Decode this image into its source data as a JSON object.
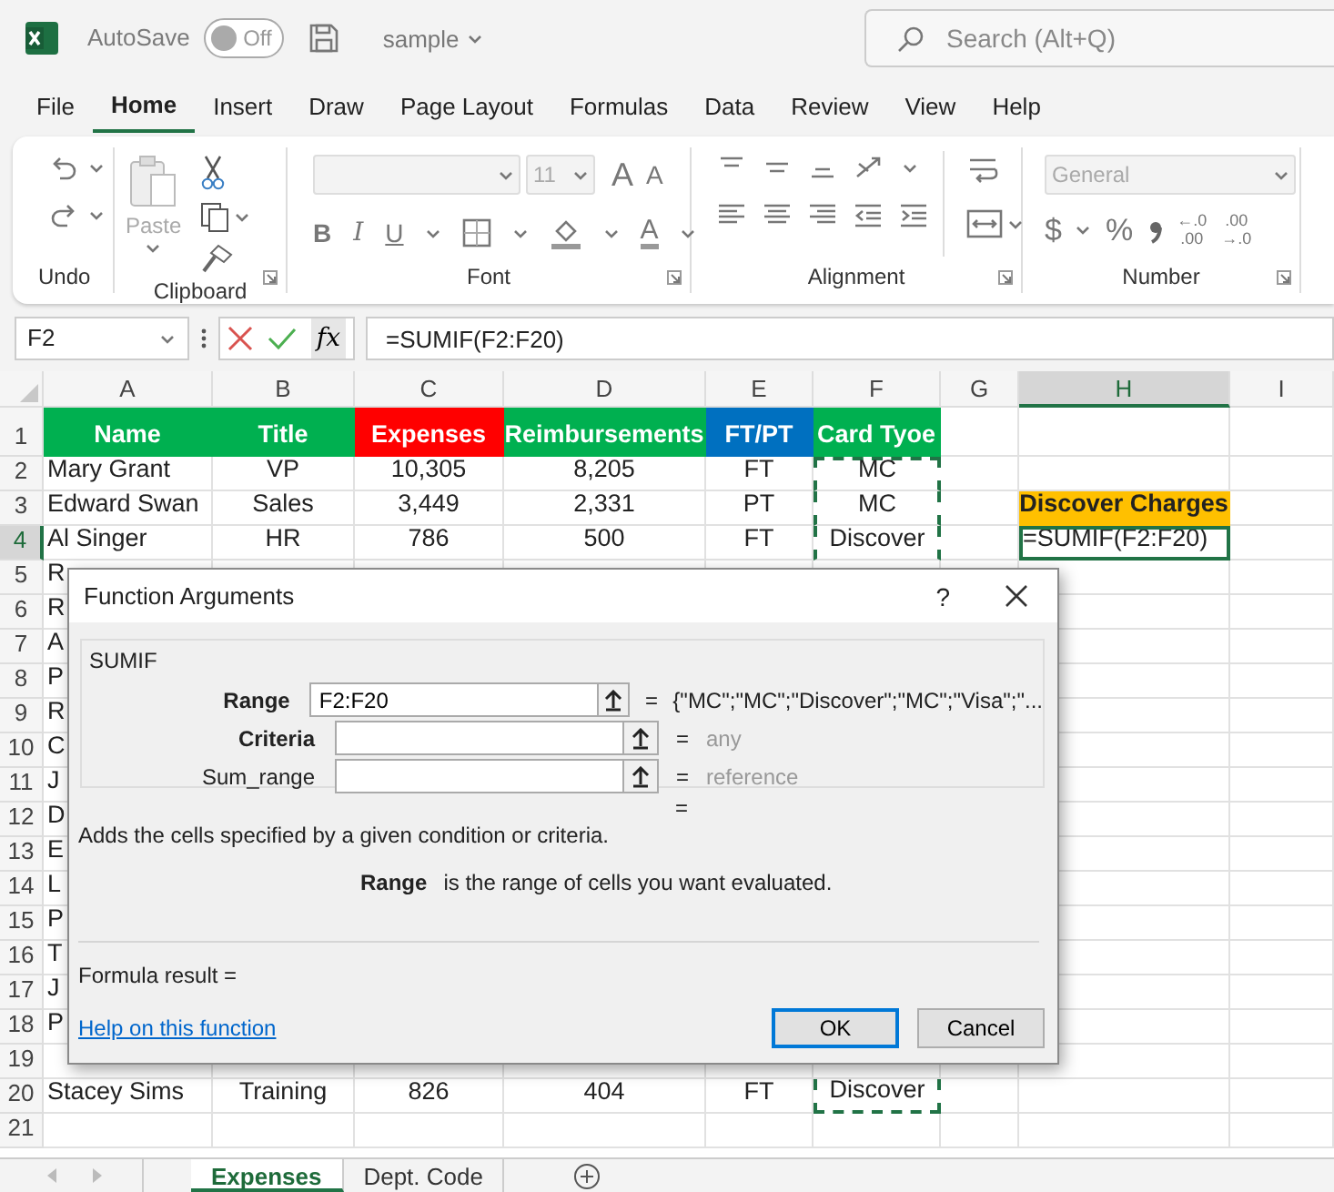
{
  "title_bar": {
    "autosave_label": "AutoSave",
    "autosave_on": false,
    "autosave_state": "Off",
    "file_name": "sample",
    "search_placeholder": "Search (Alt+Q)"
  },
  "menu_tabs": [
    {
      "label": "File",
      "selected": false
    },
    {
      "label": "Home",
      "selected": true
    },
    {
      "label": "Insert",
      "selected": false
    },
    {
      "label": "Draw",
      "selected": false
    },
    {
      "label": "Page Layout",
      "selected": false
    },
    {
      "label": "Formulas",
      "selected": false
    },
    {
      "label": "Data",
      "selected": false
    },
    {
      "label": "Review",
      "selected": false
    },
    {
      "label": "View",
      "selected": false
    },
    {
      "label": "Help",
      "selected": false
    }
  ],
  "ribbon": {
    "groups": [
      {
        "kind": "undo",
        "label": "Undo",
        "launcher": false
      },
      {
        "kind": "clipboard",
        "label": "Clipboard",
        "launcher": true
      },
      {
        "kind": "font",
        "label": "Font",
        "launcher": true
      },
      {
        "kind": "alignment",
        "label": "Alignment",
        "launcher": true
      },
      {
        "kind": "number",
        "label": "Number",
        "launcher": true
      }
    ],
    "paste_label": "Paste",
    "font_size": "11",
    "number_format": "General",
    "font_glyphs": {
      "grow": "A",
      "shrink": "A",
      "bold": "B",
      "italic": "I",
      "underline": "U",
      "font_colour": "A"
    },
    "number_glyphs": {
      "currency": "$",
      "percent": "%"
    },
    "decimal_increase": [
      "←.0",
      ".00"
    ],
    "decimal_decrease": [
      ".00",
      "→.0"
    ]
  },
  "formula_bar": {
    "name_box": "F2",
    "insert_function": "fx",
    "formula": "=SUMIF(F2:F20)"
  },
  "sheet": {
    "columns": [
      {
        "label": "A",
        "selected": false
      },
      {
        "label": "B",
        "selected": false
      },
      {
        "label": "C",
        "selected": false
      },
      {
        "label": "D",
        "selected": false
      },
      {
        "label": "E",
        "selected": false
      },
      {
        "label": "F",
        "selected": false
      },
      {
        "label": "G",
        "selected": false
      },
      {
        "label": "H",
        "selected": true
      },
      {
        "label": "I",
        "selected": false
      }
    ],
    "rows": [
      {
        "number": "1",
        "selected": false,
        "cells": [
          {
            "text": "Name",
            "color": "#00b050",
            "selected": false,
            "marquee": false
          },
          {
            "text": "Title",
            "color": "#00b050",
            "selected": false,
            "marquee": false
          },
          {
            "text": "Expenses",
            "color": "#ff0000",
            "selected": false,
            "marquee": false
          },
          {
            "text": "Reimbursements",
            "color": "#00b050",
            "selected": false,
            "marquee": false
          },
          {
            "text": "FT/PT",
            "color": "#0070c0",
            "selected": false,
            "marquee": false
          },
          {
            "text": "Card Tyoe",
            "color": "#00b050",
            "selected": false,
            "marquee": false
          }
        ]
      },
      {
        "number": "2",
        "selected": false,
        "cells": [
          {
            "text": "Mary Grant",
            "selected": false,
            "marquee": false
          },
          {
            "text": "VP",
            "selected": false,
            "marquee": false
          },
          {
            "text": "10,305",
            "selected": false,
            "marquee": false
          },
          {
            "text": "8,205",
            "selected": false,
            "marquee": false
          },
          {
            "text": "FT",
            "selected": false,
            "marquee": false
          },
          {
            "text": "MC",
            "selected": false,
            "marquee": true
          }
        ]
      },
      {
        "number": "3",
        "selected": false,
        "cells": [
          {
            "text": "Edward Swan",
            "selected": false,
            "marquee": false
          },
          {
            "text": "Sales",
            "selected": false,
            "marquee": false
          },
          {
            "text": "3,449",
            "selected": false,
            "marquee": false
          },
          {
            "text": "2,331",
            "selected": false,
            "marquee": false
          },
          {
            "text": "PT",
            "selected": false,
            "marquee": false
          },
          {
            "text": "MC",
            "selected": false,
            "marquee": true
          },
          null,
          {
            "text": "Discover Charges",
            "color": "#ffc000",
            "selected": false,
            "marquee": false
          }
        ]
      },
      {
        "number": "4",
        "selected": true,
        "cells": [
          {
            "text": "Al Singer",
            "selected": false,
            "marquee": false
          },
          {
            "text": "HR",
            "selected": false,
            "marquee": false
          },
          {
            "text": "786",
            "selected": false,
            "marquee": false
          },
          {
            "text": "500",
            "selected": false,
            "marquee": false
          },
          {
            "text": "FT",
            "selected": false,
            "marquee": false
          },
          {
            "text": "Discover",
            "selected": false,
            "marquee": true
          },
          null,
          {
            "text": "=SUMIF(F2:F20)",
            "selected": true,
            "marquee": false
          }
        ]
      },
      {
        "number": "5",
        "selected": false,
        "cells": [
          {
            "text": "R",
            "selected": false,
            "marquee": false
          }
        ]
      },
      {
        "number": "6",
        "selected": false,
        "cells": [
          {
            "text": "R",
            "selected": false,
            "marquee": false
          }
        ]
      },
      {
        "number": "7",
        "selected": false,
        "cells": [
          {
            "text": "A",
            "selected": false,
            "marquee": false
          }
        ]
      },
      {
        "number": "8",
        "selected": false,
        "cells": [
          {
            "text": "P",
            "selected": false,
            "marquee": false
          }
        ]
      },
      {
        "number": "9",
        "selected": false,
        "cells": [
          {
            "text": "R",
            "selected": false,
            "marquee": false
          }
        ]
      },
      {
        "number": "10",
        "selected": false,
        "cells": [
          {
            "text": "C",
            "selected": false,
            "marquee": false
          }
        ]
      },
      {
        "number": "11",
        "selected": false,
        "cells": [
          {
            "text": "J",
            "selected": false,
            "marquee": false
          }
        ]
      },
      {
        "number": "12",
        "selected": false,
        "cells": [
          {
            "text": "D",
            "selected": false,
            "marquee": false
          }
        ]
      },
      {
        "number": "13",
        "selected": false,
        "cells": [
          {
            "text": "E",
            "selected": false,
            "marquee": false
          }
        ]
      },
      {
        "number": "14",
        "selected": false,
        "cells": [
          {
            "text": "L",
            "selected": false,
            "marquee": false
          }
        ]
      },
      {
        "number": "15",
        "selected": false,
        "cells": [
          {
            "text": "P",
            "selected": false,
            "marquee": false
          }
        ]
      },
      {
        "number": "16",
        "selected": false,
        "cells": [
          {
            "text": "T",
            "selected": false,
            "marquee": false
          }
        ]
      },
      {
        "number": "17",
        "selected": false,
        "cells": [
          {
            "text": "J",
            "selected": false,
            "marquee": false
          }
        ]
      },
      {
        "number": "18",
        "selected": false,
        "cells": [
          {
            "text": "P",
            "selected": false,
            "marquee": false
          }
        ]
      },
      {
        "number": "19",
        "selected": false,
        "cells": []
      },
      {
        "number": "20",
        "selected": false,
        "cells": [
          {
            "text": "Stacey Sims",
            "selected": false,
            "marquee": false
          },
          {
            "text": "Training",
            "selected": false,
            "marquee": false
          },
          {
            "text": "826",
            "selected": false,
            "marquee": false
          },
          {
            "text": "404",
            "selected": false,
            "marquee": false
          },
          {
            "text": "FT",
            "selected": false,
            "marquee": false
          },
          {
            "text": "Discover",
            "selected": false,
            "marquee": true
          }
        ]
      },
      {
        "number": "21",
        "selected": false,
        "cells": []
      }
    ]
  },
  "dialog": {
    "title": "Function Arguments",
    "help_glyph": "?",
    "function_name": "SUMIF",
    "arguments": [
      {
        "label": "Range",
        "required": true,
        "value": "F2:F20",
        "equals": "=",
        "result": "{\"MC\";\"MC\";\"Discover\";\"MC\";\"Visa\";\"...",
        "muted": false
      },
      {
        "label": "Criteria",
        "required": true,
        "equals": "=",
        "result": "any",
        "muted": true
      },
      {
        "label": "Sum_range",
        "required": false,
        "equals": "=",
        "result": "reference",
        "muted": true
      }
    ],
    "total_equals": "=",
    "description": "Adds the cells specified by a given condition or criteria.",
    "argument_help": {
      "name": "Range",
      "text": "is the range of cells you want evaluated."
    },
    "formula_result": "Formula result =",
    "help_link": "Help on this function",
    "buttons": [
      {
        "label": "OK",
        "default": true
      },
      {
        "label": "Cancel",
        "default": false
      }
    ]
  },
  "sheet_tabs": [
    {
      "label": "Expenses",
      "selected": true
    },
    {
      "label": "Dept. Code",
      "selected": false
    }
  ]
}
